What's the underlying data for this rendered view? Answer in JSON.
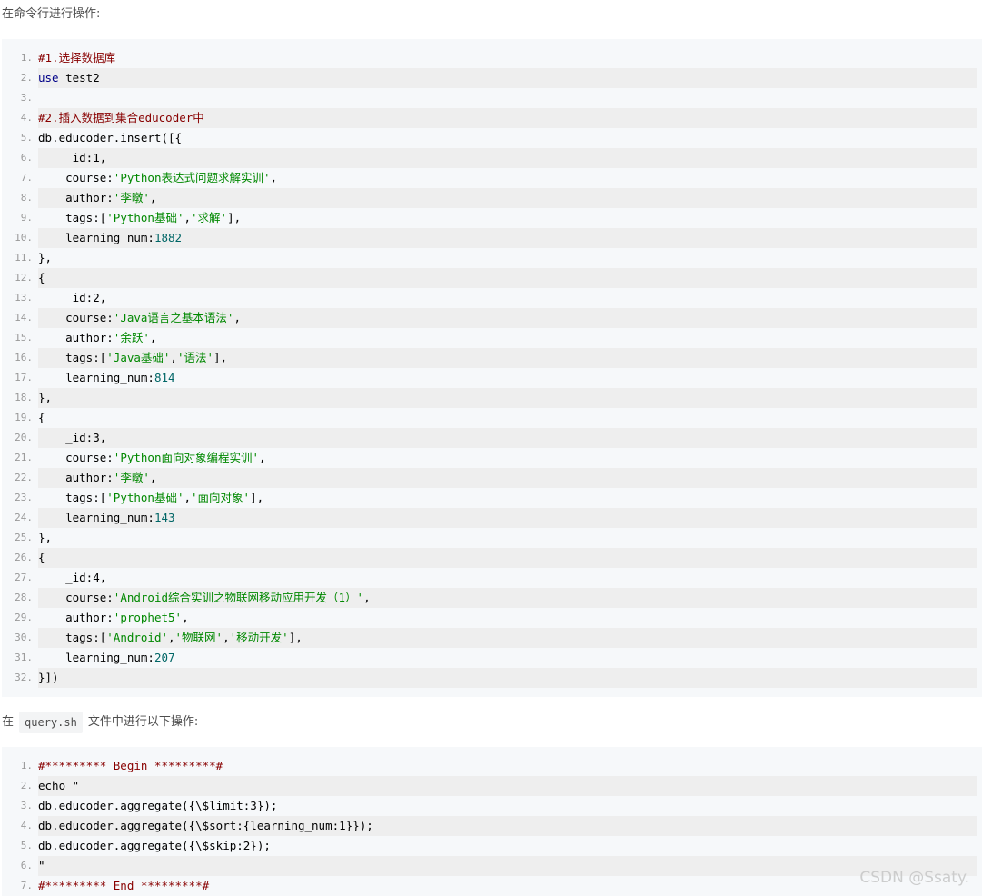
{
  "intro_text": "在命令行进行操作:",
  "block1": [
    {
      "n": "1.",
      "parts": [
        {
          "t": "#1.选择数据库",
          "c": "comment"
        }
      ]
    },
    {
      "n": "2.",
      "parts": [
        {
          "t": "use",
          "c": "kw"
        },
        {
          "t": " test2",
          "c": ""
        }
      ]
    },
    {
      "n": "3.",
      "parts": [
        {
          "t": "",
          "c": ""
        }
      ]
    },
    {
      "n": "4.",
      "parts": [
        {
          "t": "#2.插入数据到集合educoder中",
          "c": "comment"
        }
      ]
    },
    {
      "n": "5.",
      "parts": [
        {
          "t": "db.educoder.insert([{",
          "c": ""
        }
      ]
    },
    {
      "n": "6.",
      "parts": [
        {
          "t": "    _id:",
          "c": ""
        },
        {
          "t": "1",
          "c": ""
        },
        {
          "t": ",",
          "c": ""
        }
      ]
    },
    {
      "n": "7.",
      "parts": [
        {
          "t": "    course:",
          "c": ""
        },
        {
          "t": "'Python表达式问题求解实训'",
          "c": "str"
        },
        {
          "t": ",",
          "c": ""
        }
      ]
    },
    {
      "n": "8.",
      "parts": [
        {
          "t": "    author:",
          "c": ""
        },
        {
          "t": "'李暾'",
          "c": "str"
        },
        {
          "t": ",",
          "c": ""
        }
      ]
    },
    {
      "n": "9.",
      "parts": [
        {
          "t": "    tags:[",
          "c": ""
        },
        {
          "t": "'Python基础'",
          "c": "str"
        },
        {
          "t": ",",
          "c": ""
        },
        {
          "t": "'求解'",
          "c": "str"
        },
        {
          "t": "],",
          "c": ""
        }
      ]
    },
    {
      "n": "10.",
      "parts": [
        {
          "t": "    learning_num:",
          "c": ""
        },
        {
          "t": "1882",
          "c": "num"
        }
      ]
    },
    {
      "n": "11.",
      "parts": [
        {
          "t": "},",
          "c": ""
        }
      ]
    },
    {
      "n": "12.",
      "parts": [
        {
          "t": "{",
          "c": ""
        }
      ]
    },
    {
      "n": "13.",
      "parts": [
        {
          "t": "    _id:",
          "c": ""
        },
        {
          "t": "2",
          "c": ""
        },
        {
          "t": ",",
          "c": ""
        }
      ]
    },
    {
      "n": "14.",
      "parts": [
        {
          "t": "    course:",
          "c": ""
        },
        {
          "t": "'Java语言之基本语法'",
          "c": "str"
        },
        {
          "t": ",",
          "c": ""
        }
      ]
    },
    {
      "n": "15.",
      "parts": [
        {
          "t": "    author:",
          "c": ""
        },
        {
          "t": "'余跃'",
          "c": "str"
        },
        {
          "t": ",",
          "c": ""
        }
      ]
    },
    {
      "n": "16.",
      "parts": [
        {
          "t": "    tags:[",
          "c": ""
        },
        {
          "t": "'Java基础'",
          "c": "str"
        },
        {
          "t": ",",
          "c": ""
        },
        {
          "t": "'语法'",
          "c": "str"
        },
        {
          "t": "],",
          "c": ""
        }
      ]
    },
    {
      "n": "17.",
      "parts": [
        {
          "t": "    learning_num:",
          "c": ""
        },
        {
          "t": "814",
          "c": "num"
        }
      ]
    },
    {
      "n": "18.",
      "parts": [
        {
          "t": "},",
          "c": ""
        }
      ]
    },
    {
      "n": "19.",
      "parts": [
        {
          "t": "{",
          "c": ""
        }
      ]
    },
    {
      "n": "20.",
      "parts": [
        {
          "t": "    _id:",
          "c": ""
        },
        {
          "t": "3",
          "c": ""
        },
        {
          "t": ",",
          "c": ""
        }
      ]
    },
    {
      "n": "21.",
      "parts": [
        {
          "t": "    course:",
          "c": ""
        },
        {
          "t": "'Python面向对象编程实训'",
          "c": "str"
        },
        {
          "t": ",",
          "c": ""
        }
      ]
    },
    {
      "n": "22.",
      "parts": [
        {
          "t": "    author:",
          "c": ""
        },
        {
          "t": "'李暾'",
          "c": "str"
        },
        {
          "t": ",",
          "c": ""
        }
      ]
    },
    {
      "n": "23.",
      "parts": [
        {
          "t": "    tags:[",
          "c": ""
        },
        {
          "t": "'Python基础'",
          "c": "str"
        },
        {
          "t": ",",
          "c": ""
        },
        {
          "t": "'面向对象'",
          "c": "str"
        },
        {
          "t": "],",
          "c": ""
        }
      ]
    },
    {
      "n": "24.",
      "parts": [
        {
          "t": "    learning_num:",
          "c": ""
        },
        {
          "t": "143",
          "c": "num"
        }
      ]
    },
    {
      "n": "25.",
      "parts": [
        {
          "t": "},",
          "c": ""
        }
      ]
    },
    {
      "n": "26.",
      "parts": [
        {
          "t": "{",
          "c": ""
        }
      ]
    },
    {
      "n": "27.",
      "parts": [
        {
          "t": "    _id:",
          "c": ""
        },
        {
          "t": "4",
          "c": ""
        },
        {
          "t": ",",
          "c": ""
        }
      ]
    },
    {
      "n": "28.",
      "parts": [
        {
          "t": "    course:",
          "c": ""
        },
        {
          "t": "'Android综合实训之物联网移动应用开发（1）'",
          "c": "str"
        },
        {
          "t": ",",
          "c": ""
        }
      ]
    },
    {
      "n": "29.",
      "parts": [
        {
          "t": "    author:",
          "c": ""
        },
        {
          "t": "'prophet5'",
          "c": "str"
        },
        {
          "t": ",",
          "c": ""
        }
      ]
    },
    {
      "n": "30.",
      "parts": [
        {
          "t": "    tags:[",
          "c": ""
        },
        {
          "t": "'Android'",
          "c": "str"
        },
        {
          "t": ",",
          "c": ""
        },
        {
          "t": "'物联网'",
          "c": "str"
        },
        {
          "t": ",",
          "c": ""
        },
        {
          "t": "'移动开发'",
          "c": "str"
        },
        {
          "t": "],",
          "c": ""
        }
      ]
    },
    {
      "n": "31.",
      "parts": [
        {
          "t": "    learning_num:",
          "c": ""
        },
        {
          "t": "207",
          "c": "num"
        }
      ]
    },
    {
      "n": "32.",
      "parts": [
        {
          "t": "}])",
          "c": ""
        }
      ]
    }
  ],
  "middle_prefix": "在",
  "middle_code": "query.sh",
  "middle_suffix": "文件中进行以下操作:",
  "block2": [
    {
      "n": "1.",
      "parts": [
        {
          "t": "#********* Begin *********#",
          "c": "comment"
        }
      ]
    },
    {
      "n": "2.",
      "parts": [
        {
          "t": "echo \"",
          "c": ""
        }
      ]
    },
    {
      "n": "3.",
      "parts": [
        {
          "t": "db.educoder.aggregate({\\$limit:3});",
          "c": ""
        }
      ]
    },
    {
      "n": "4.",
      "parts": [
        {
          "t": "db.educoder.aggregate({\\$sort:{learning_num:1}});",
          "c": ""
        }
      ]
    },
    {
      "n": "5.",
      "parts": [
        {
          "t": "db.educoder.aggregate({\\$skip:2});",
          "c": ""
        }
      ]
    },
    {
      "n": "6.",
      "parts": [
        {
          "t": "\"",
          "c": ""
        }
      ]
    },
    {
      "n": "7.",
      "parts": [
        {
          "t": "#********* End *********#",
          "c": "comment"
        }
      ]
    }
  ],
  "watermark": "CSDN @Ssaty."
}
